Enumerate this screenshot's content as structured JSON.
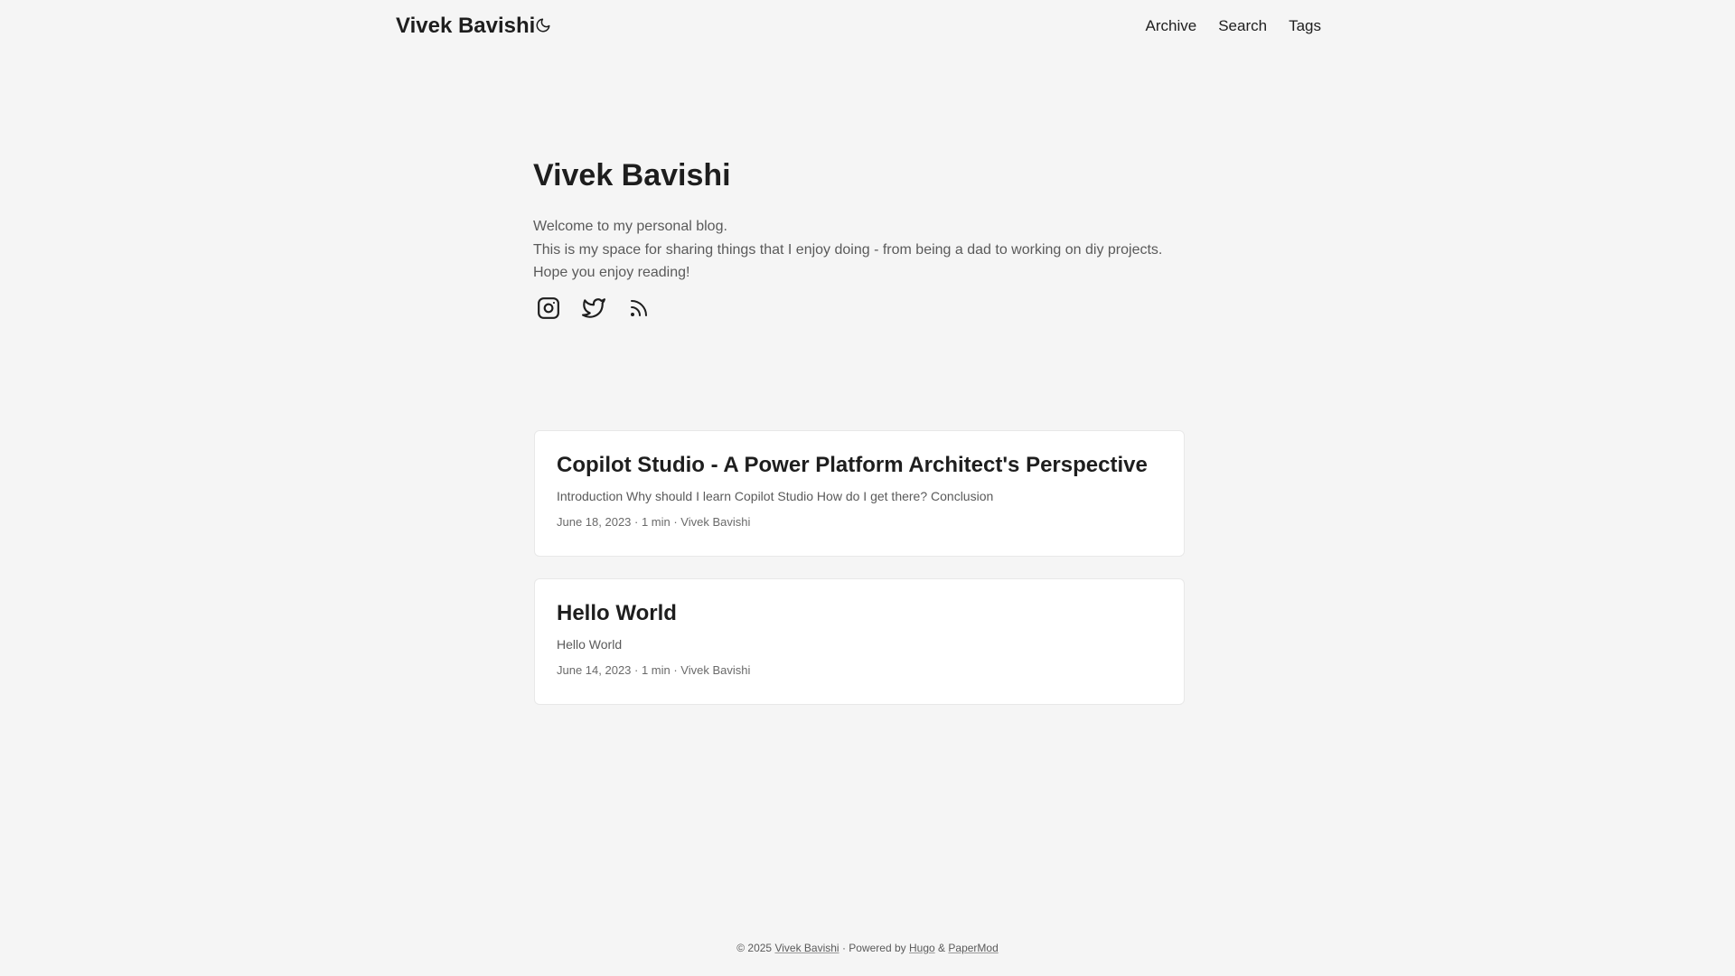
{
  "header": {
    "logo": "Vivek Bavishi",
    "theme_toggle_icon": "moon-icon",
    "nav": [
      "Archive",
      "Search",
      "Tags"
    ]
  },
  "profile": {
    "title": "Vivek Bavishi",
    "intro_lines": [
      "Welcome to my personal blog.",
      "This is my space for sharing things that I enjoy doing - from being a dad to working on diy projects.",
      "Hope you enjoy reading!"
    ],
    "social_icons": [
      "instagram-icon",
      "twitter-icon",
      "rss-icon"
    ]
  },
  "posts": [
    {
      "title": "Copilot Studio - A Power Platform Architect's Perspective",
      "summary": "Introduction Why should I learn Copilot Studio How do I get there? Conclusion",
      "meta": "June 18, 2023 · 1 min · Vivek Bavishi"
    },
    {
      "title": "Hello World",
      "summary": "Hello World",
      "meta": "June 14, 2023 · 1 min · Vivek Bavishi"
    }
  ],
  "footer": {
    "copyright": "© 2025",
    "author_link": "Vivek Bavishi",
    "separator": "·",
    "powered_by": "Powered by",
    "hugo_link": "Hugo",
    "ampersand": "&",
    "theme_link": "PaperMod"
  }
}
